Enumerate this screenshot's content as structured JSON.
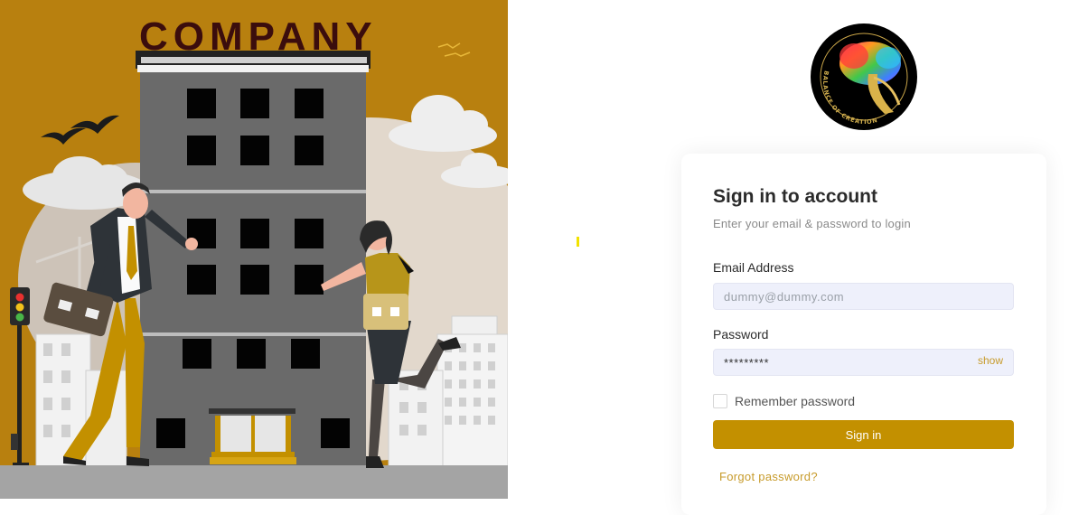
{
  "hero": {
    "sign_text": "COMPANY"
  },
  "logo": {
    "ring_text": "BALANCE OF CREATION"
  },
  "login": {
    "title": "Sign in to account",
    "subtitle": "Enter your email & password to login",
    "email_label": "Email Address",
    "email_placeholder": "dummy@dummy.com",
    "password_label": "Password",
    "password_value": "*********",
    "show_label": "show",
    "remember_label": "Remember password",
    "signin_label": "Sign in",
    "forgot_label": "Forgot password?"
  },
  "colors": {
    "accent": "#c39000",
    "hero_bg": "#b8800f",
    "link": "#c79b2b",
    "input_bg": "#eef0fb"
  }
}
